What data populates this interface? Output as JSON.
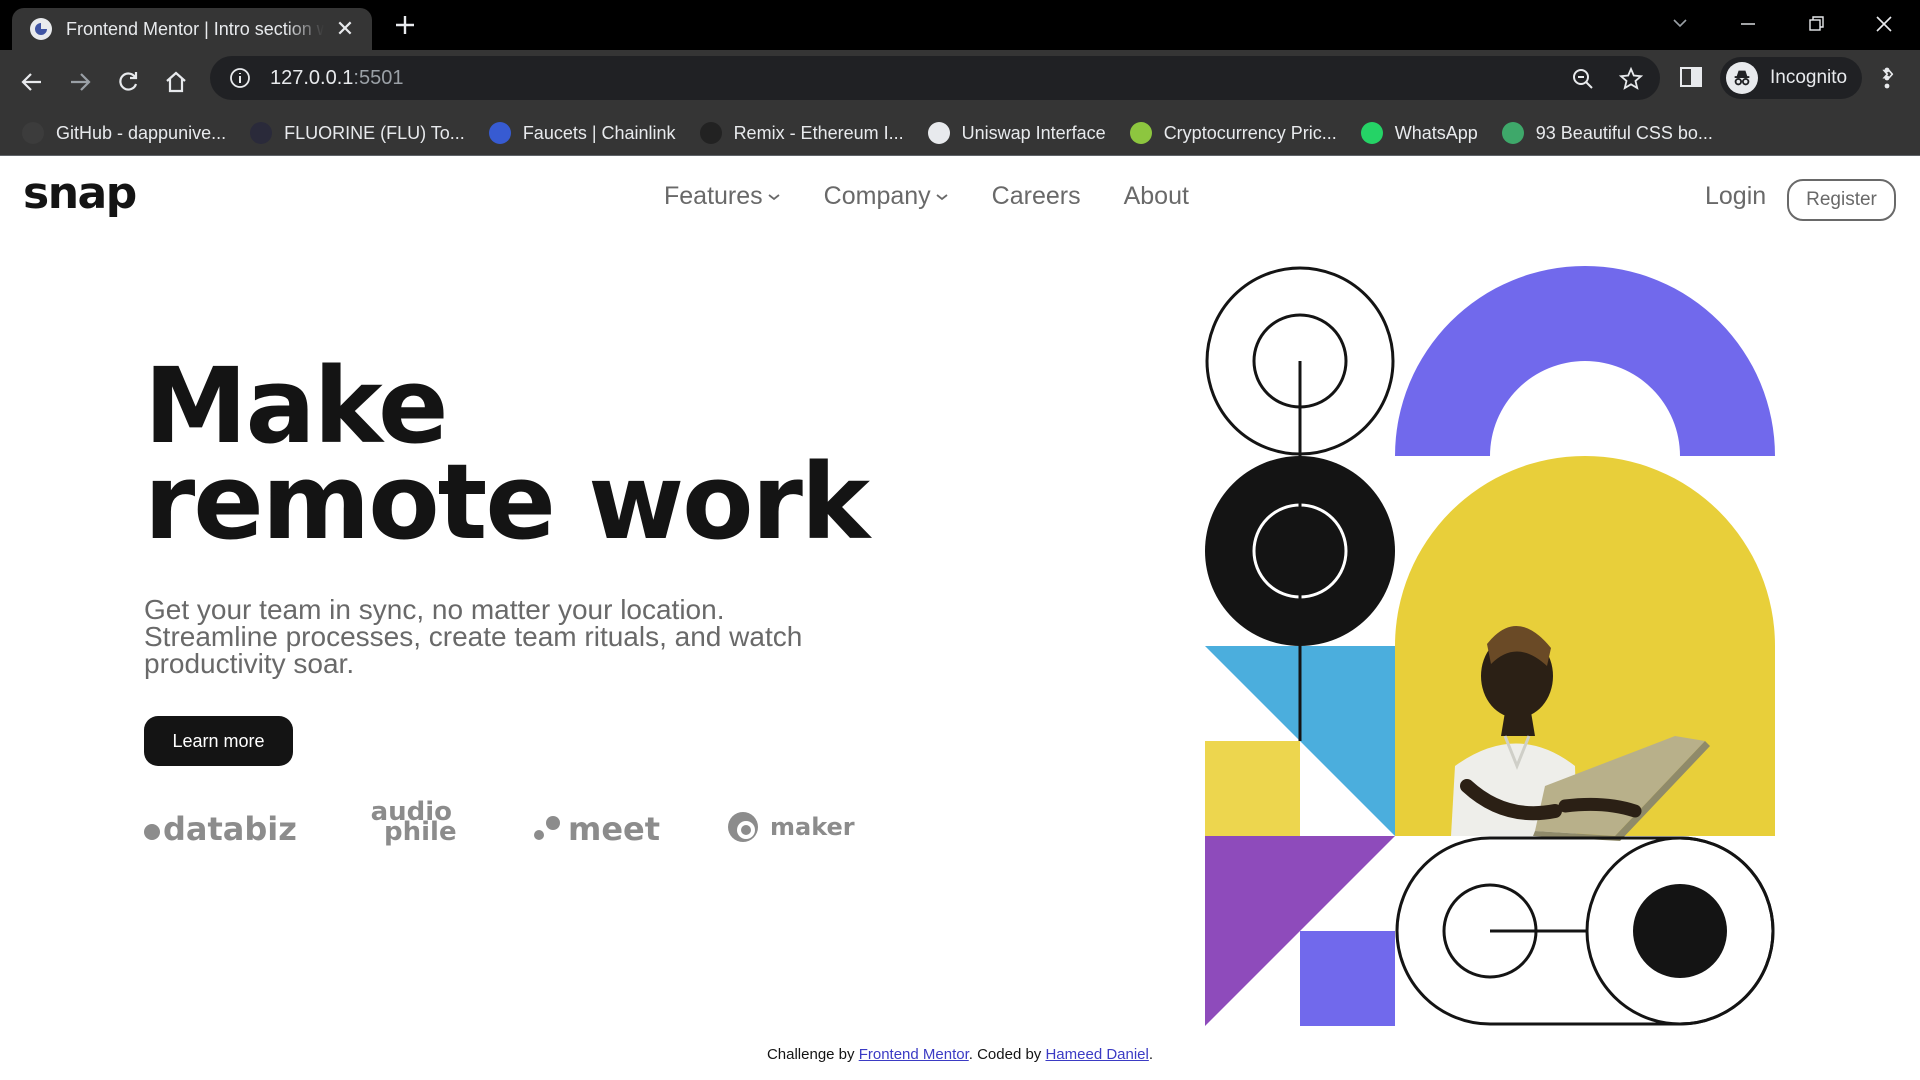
{
  "browser": {
    "tab_title": "Frontend Mentor | Intro section w",
    "url_host": "127.0.0.1",
    "url_port": ":5501",
    "profile_label": "Incognito",
    "bookmarks": [
      {
        "label": "GitHub - dappunive...",
        "color": "#3c3c3c"
      },
      {
        "label": "FLUORINE (FLU) To...",
        "color": "#2a2a3a"
      },
      {
        "label": "Faucets | Chainlink",
        "color": "#375bd2"
      },
      {
        "label": "Remix - Ethereum I...",
        "color": "#222222"
      },
      {
        "label": "Uniswap Interface",
        "color": "#e8eaed"
      },
      {
        "label": "Cryptocurrency Pric...",
        "color": "#8dc63f"
      },
      {
        "label": "WhatsApp",
        "color": "#25d366"
      },
      {
        "label": "93 Beautiful CSS bo...",
        "color": "#3ea86a"
      }
    ]
  },
  "site": {
    "logo": "snap",
    "nav": [
      {
        "label": "Features",
        "dropdown": true
      },
      {
        "label": "Company",
        "dropdown": true
      },
      {
        "label": "Careers",
        "dropdown": false
      },
      {
        "label": "About",
        "dropdown": false
      }
    ],
    "login": "Login",
    "register": "Register",
    "hero_title_line1": "Make",
    "hero_title_line2": "remote work",
    "hero_subtitle": "Get your team in sync, no matter your location. Streamline processes, create team rituals, and watch productivity soar.",
    "cta": "Learn more",
    "clients": {
      "databiz": "databiz",
      "audiophile_top": "audio",
      "audiophile_bottom": "phile",
      "meet": "meet",
      "maker": "maker"
    },
    "footer_prefix": "Challenge by ",
    "footer_link1": "Frontend Mentor",
    "footer_mid": ". Coded by ",
    "footer_link2": "Hameed Daniel",
    "footer_suffix": "."
  },
  "colors": {
    "dark": "#141414",
    "gray": "#696969",
    "purple": "#7169ec",
    "yellow": "#edd64e",
    "blue": "#4baedd",
    "violet": "#8e4bbb"
  }
}
